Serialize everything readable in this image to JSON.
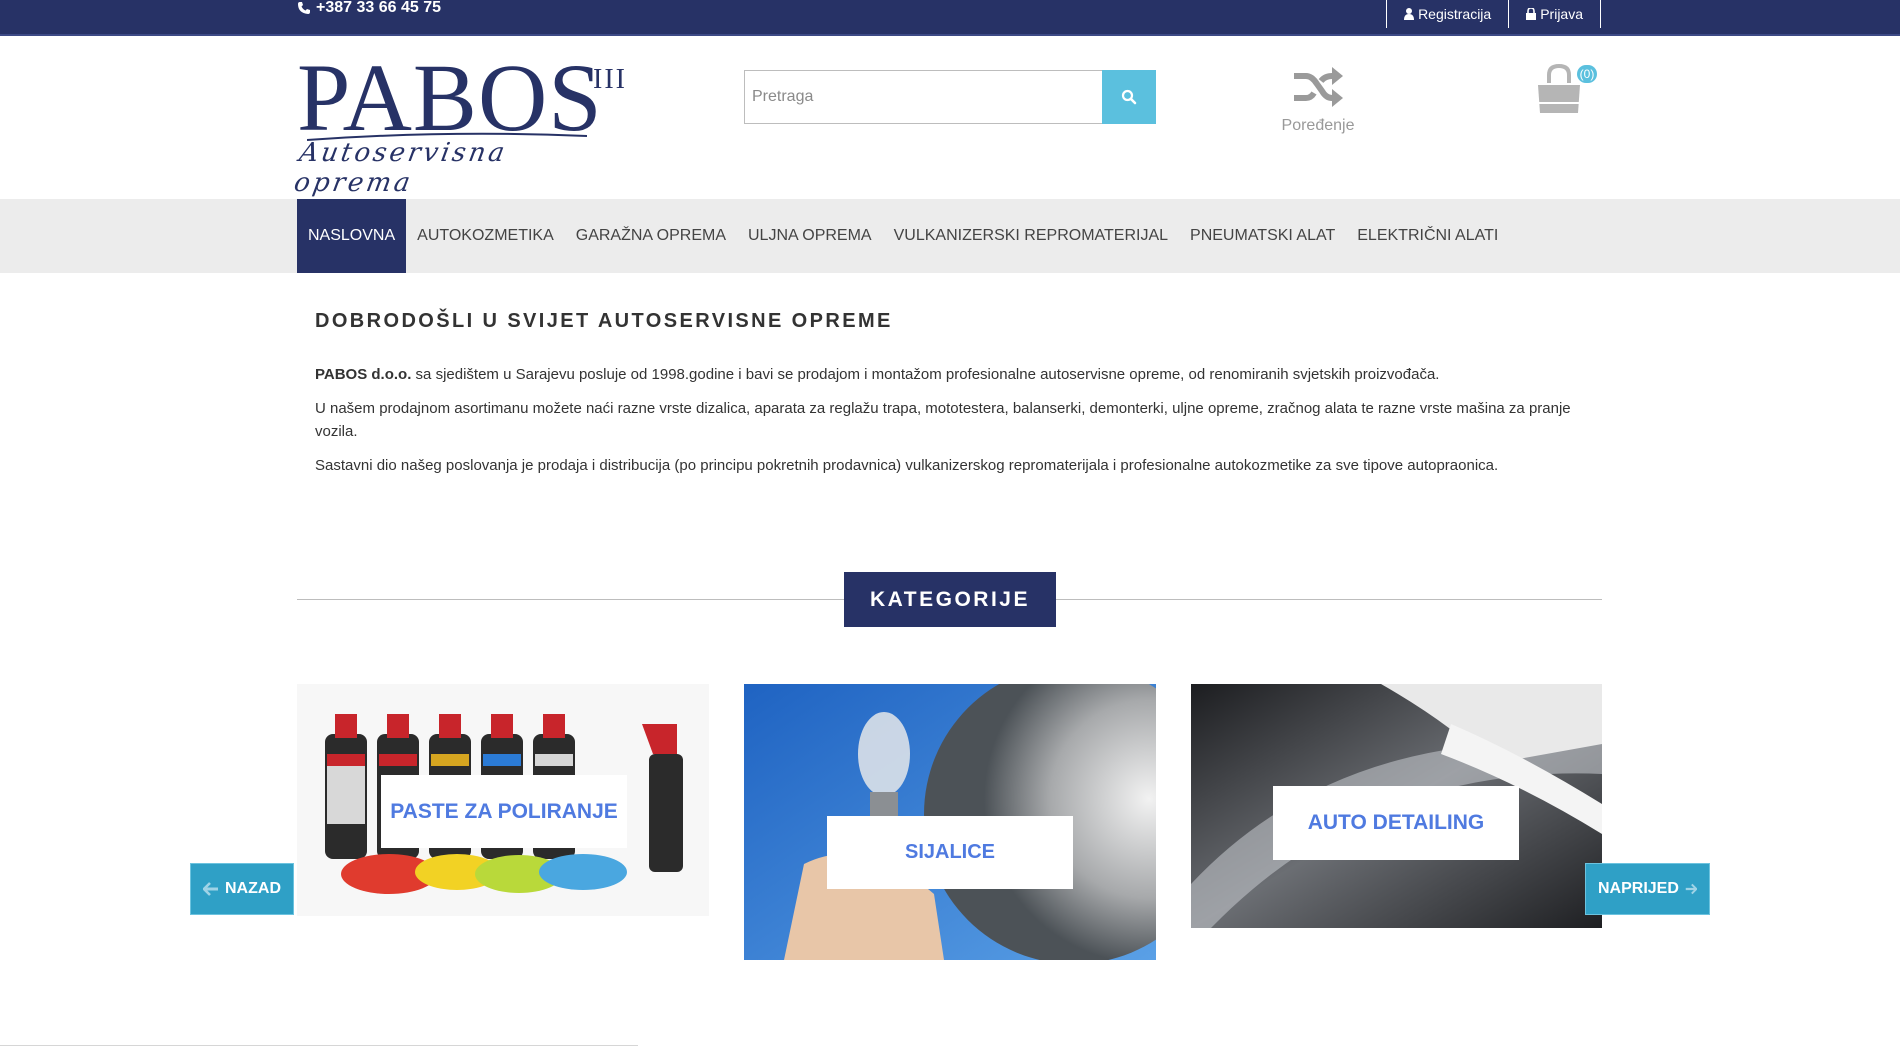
{
  "topbar": {
    "phone": "+387 33 66 45 75",
    "register": "Registracija",
    "login": "Prijava"
  },
  "logo": {
    "name": "PABOS",
    "sup": "III",
    "tagline": "Autoservisna oprema"
  },
  "search": {
    "placeholder": "Pretraga"
  },
  "compare": {
    "label": "Poređenje"
  },
  "cart": {
    "count": "(0)"
  },
  "nav": {
    "items": [
      {
        "label": "Naslovna",
        "active": true
      },
      {
        "label": "Autokozmetika"
      },
      {
        "label": "Garažna oprema"
      },
      {
        "label": "Uljna oprema"
      },
      {
        "label": "Vulkanizerski repromaterijal"
      },
      {
        "label": "Pneumatski alat"
      },
      {
        "label": "Električni alati"
      }
    ]
  },
  "welcome": {
    "title": "DOBRODOŠLI U SVIJET AUTOSERVISNE OPREME",
    "p1_bold": "PABOS d.o.o.",
    "p1_rest": " sa sjedištem u Sarajevu posluje od 1998.godine i bavi se prodajom i montažom profesionalne autoservisne opreme, od renomiranih svjetskih proizvođača.",
    "p2": "U našem prodajnom asortimanu možete naći razne vrste dizalica, aparata za reglažu trapa, mototestera, balanserki, demonterki, uljne opreme, zračnog alata te razne vrste mašina za pranje vozila.",
    "p3": "Sastavni dio našeg poslovanja je prodaja i distribucija (po principu pokretnih prodavnica) vulkanizerskog repromaterijala i profesionalne autokozmetike za sve tipove autopraonica."
  },
  "categories": {
    "title": "KATEGORIJE",
    "items": [
      {
        "label": "Paste za poliranje"
      },
      {
        "label": "Sijalice"
      },
      {
        "label": "Auto detailing"
      }
    ],
    "prev": "NAZAD",
    "next": "NAPRIJED"
  },
  "colors": {
    "navy": "#273266",
    "accent": "#5bc0de",
    "label_text": "#4f7ae0"
  }
}
